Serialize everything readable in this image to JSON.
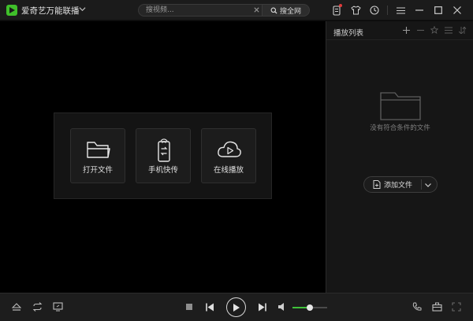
{
  "titlebar": {
    "app_title": "爱奇艺万能联播",
    "search_placeholder": "搜视频...",
    "search_button": "搜全网",
    "icons": [
      "phone-icon",
      "shirt-icon",
      "clock-icon",
      "menu-icon",
      "minimize-icon",
      "maximize-icon",
      "close-icon"
    ]
  },
  "quick_actions": [
    {
      "label": "打开文件",
      "icon": "folder-icon"
    },
    {
      "label": "手机快传",
      "icon": "phone-transfer-icon"
    },
    {
      "label": "在线播放",
      "icon": "cloud-play-icon"
    }
  ],
  "playlist": {
    "title": "播放列表",
    "empty_text": "没有符合条件的文件",
    "add_button": "添加文件",
    "tools": [
      "plus-icon",
      "minus-icon",
      "star-icon",
      "list-icon",
      "sort-icon"
    ]
  },
  "controls": {
    "volume_level": 0.5,
    "accent": "#3fc23a"
  }
}
